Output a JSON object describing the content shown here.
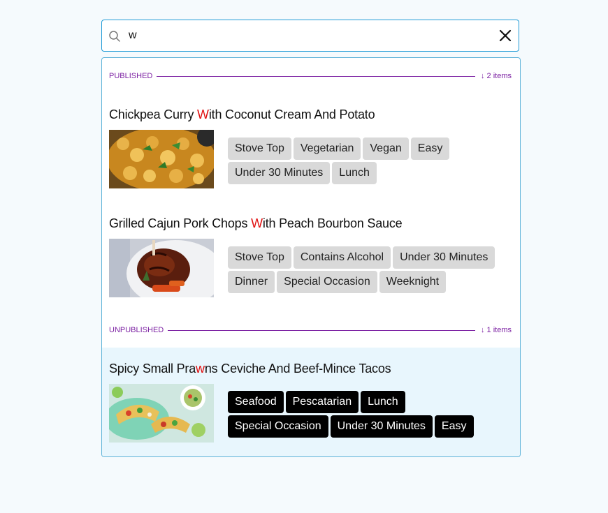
{
  "search": {
    "value": "w",
    "placeholder": ""
  },
  "sections": {
    "published": {
      "label": "PUBLISHED",
      "count": "↓ 2 items"
    },
    "unpublished": {
      "label": "UNPUBLISHED",
      "count": "↓ 1 items"
    }
  },
  "results": [
    {
      "title_before": "Chickpea Curry ",
      "title_match": "W",
      "title_after": "ith Coconut Cream And Potato",
      "tags": [
        "Stove Top",
        "Vegetarian",
        "Vegan",
        "Easy",
        "Under 30 Minutes",
        "Lunch"
      ]
    },
    {
      "title_before": "Grilled Cajun Pork Chops ",
      "title_match": "W",
      "title_after": "ith Peach Bourbon Sauce",
      "tags": [
        "Stove Top",
        "Contains Alcohol",
        "Under 30 Minutes",
        "Dinner",
        "Special Occasion",
        "Weeknight"
      ]
    },
    {
      "title_before": "Spicy Small Pra",
      "title_match": "w",
      "title_after": "ns Ceviche And Beef-Mince Tacos",
      "tags": [
        "Seafood",
        "Pescatarian",
        "Lunch",
        "Special Occasion",
        "Under 30 Minutes",
        "Easy"
      ]
    }
  ],
  "colors": {
    "accent": "#1f9ad6",
    "section_label": "#7b1fa2",
    "match_highlight": "#e01010",
    "selected_row_bg": "#e8f6fd"
  }
}
